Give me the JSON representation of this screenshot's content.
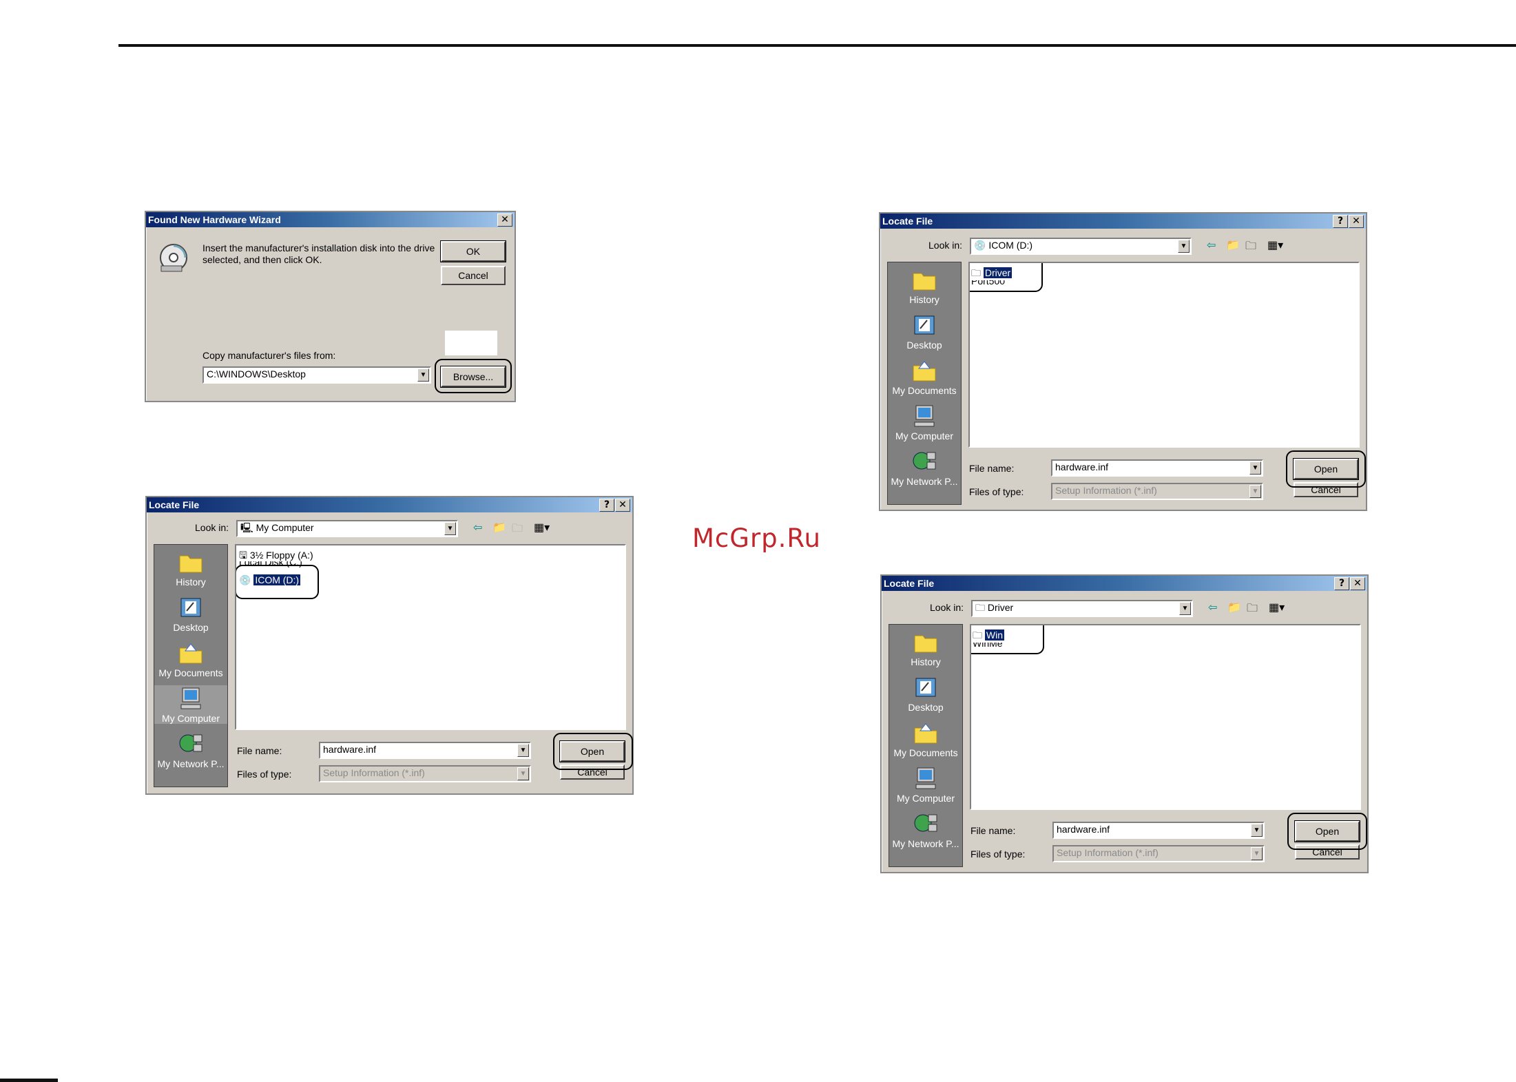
{
  "watermark": "McGrp.Ru",
  "wizard": {
    "title": "Found New Hardware Wizard",
    "close": "✕",
    "message_line1": "Insert the manufacturer's installation disk into the drive",
    "message_line2": "selected, and then click OK.",
    "ok": "OK",
    "cancel": "Cancel",
    "copy_label": "Copy manufacturer's files from:",
    "copy_value": "C:\\WINDOWS\\Desktop",
    "browse": "Browse..."
  },
  "places": [
    "History",
    "Desktop",
    "My Documents",
    "My Computer",
    "My Network P..."
  ],
  "common": {
    "help": "?",
    "close": "✕",
    "look_in": "Look in:",
    "file_name_label": "File name:",
    "file_name_value": "hardware.inf",
    "files_of_type_label": "Files of type:",
    "files_of_type_value": "Setup Information (*.inf)",
    "open": "Open",
    "cancel": "Cancel"
  },
  "locate1": {
    "title": "Locate File",
    "look_in_value": "My Computer",
    "items": [
      "3½ Floppy (A:)",
      "Local Disk (C:)",
      "ICOM (D:)"
    ]
  },
  "locate2": {
    "title": "Locate File",
    "look_in_value": "ICOM (D:)",
    "items": [
      "Driver",
      "Port500"
    ]
  },
  "locate3": {
    "title": "Locate File",
    "look_in_value": "Driver",
    "items": [
      "Win",
      "WinMe"
    ]
  }
}
